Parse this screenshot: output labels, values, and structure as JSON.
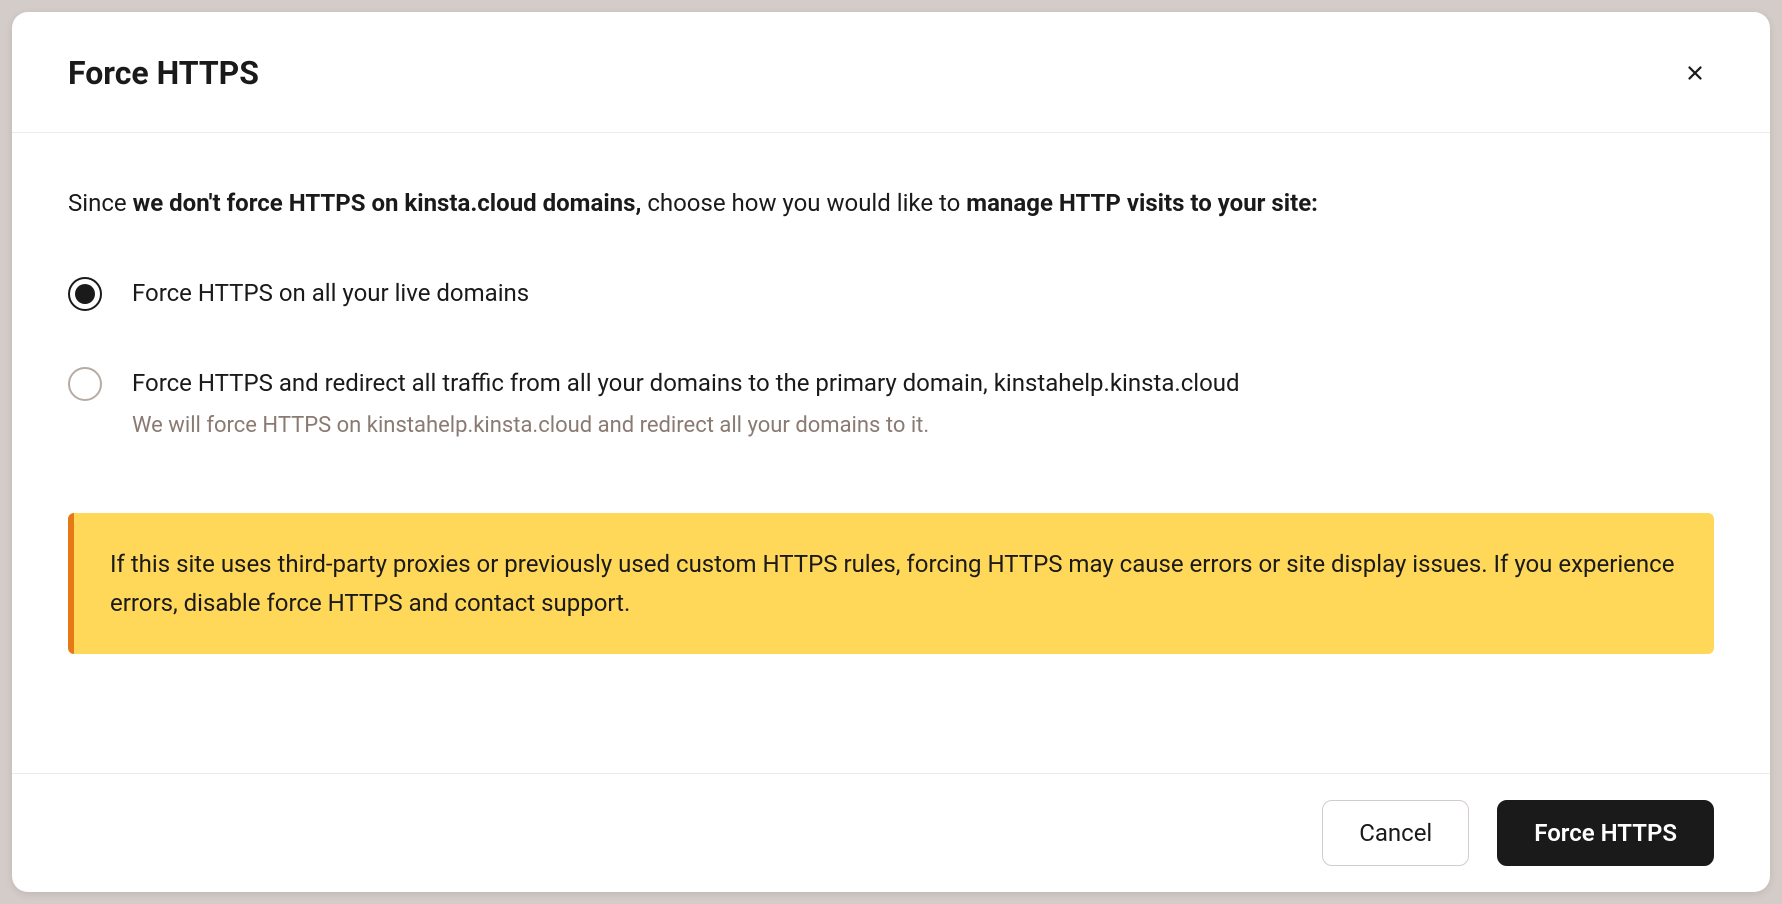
{
  "modal": {
    "title": "Force HTTPS",
    "description": {
      "part1": "Since ",
      "bold1": "we don't force HTTPS on kinsta.cloud domains,",
      "part2": " choose how you would like to ",
      "bold2": "manage HTTP visits to your site:"
    },
    "options": [
      {
        "label": "Force HTTPS on all your live domains",
        "selected": true
      },
      {
        "label": "Force HTTPS and redirect all traffic from all your domains to the primary domain, kinstahelp.kinsta.cloud",
        "sublabel": "We will force HTTPS on kinstahelp.kinsta.cloud and redirect all your domains to it.",
        "selected": false
      }
    ],
    "warning": "If this site uses third-party proxies or previously used custom HTTPS rules, forcing HTTPS may cause errors or site display issues. If you experience errors, disable force HTTPS and contact support.",
    "buttons": {
      "cancel": "Cancel",
      "confirm": "Force HTTPS"
    }
  }
}
